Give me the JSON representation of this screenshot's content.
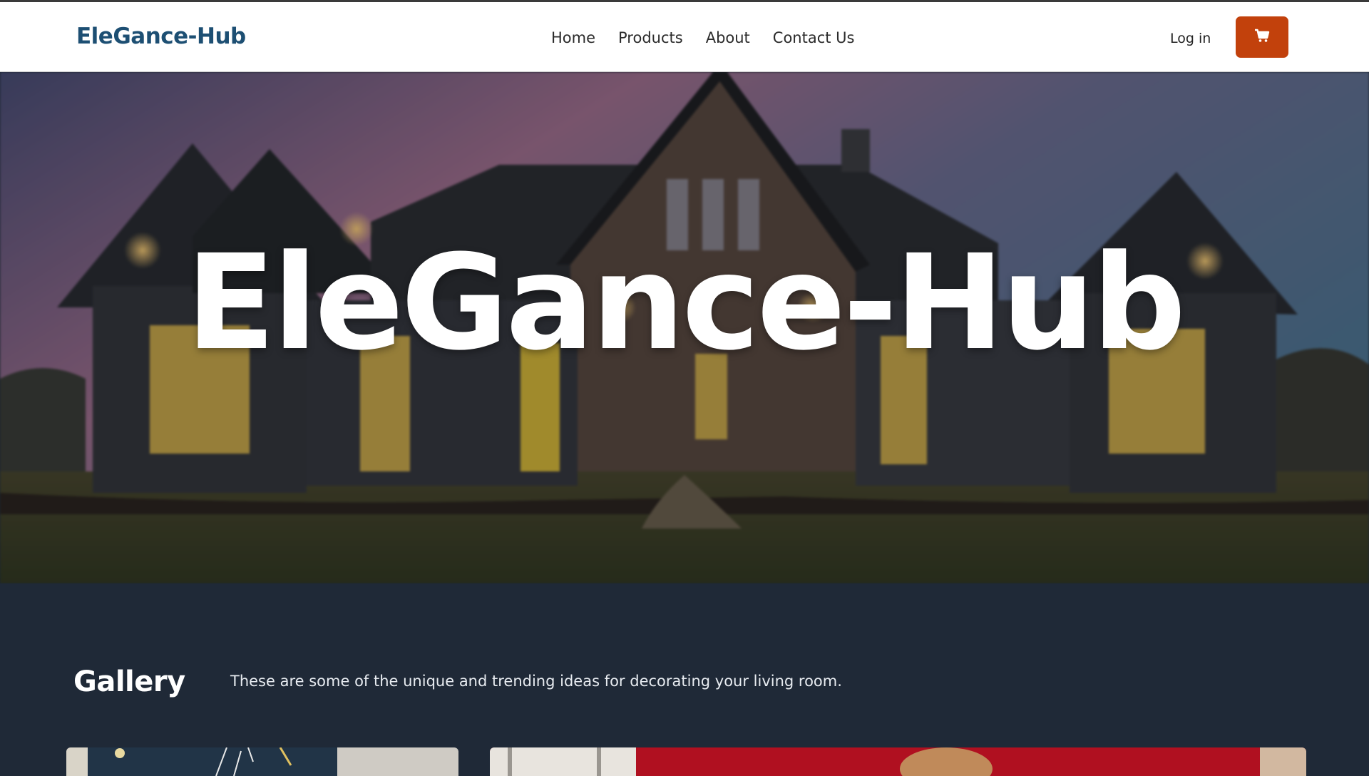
{
  "brand": {
    "name": "EleGance-Hub"
  },
  "nav": {
    "items": [
      {
        "label": "Home"
      },
      {
        "label": "Products"
      },
      {
        "label": "About"
      },
      {
        "label": "Contact Us"
      }
    ]
  },
  "header_actions": {
    "login_label": "Log in",
    "cart_icon": "cart-icon"
  },
  "hero": {
    "title": "EleGance-Hub"
  },
  "gallery": {
    "title": "Gallery",
    "description": "These are some of the unique and trending ideas for decorating your living room."
  },
  "colors": {
    "brand_text": "#1d4f73",
    "cart_button": "#c2410c",
    "section_background": "#1f2937"
  }
}
